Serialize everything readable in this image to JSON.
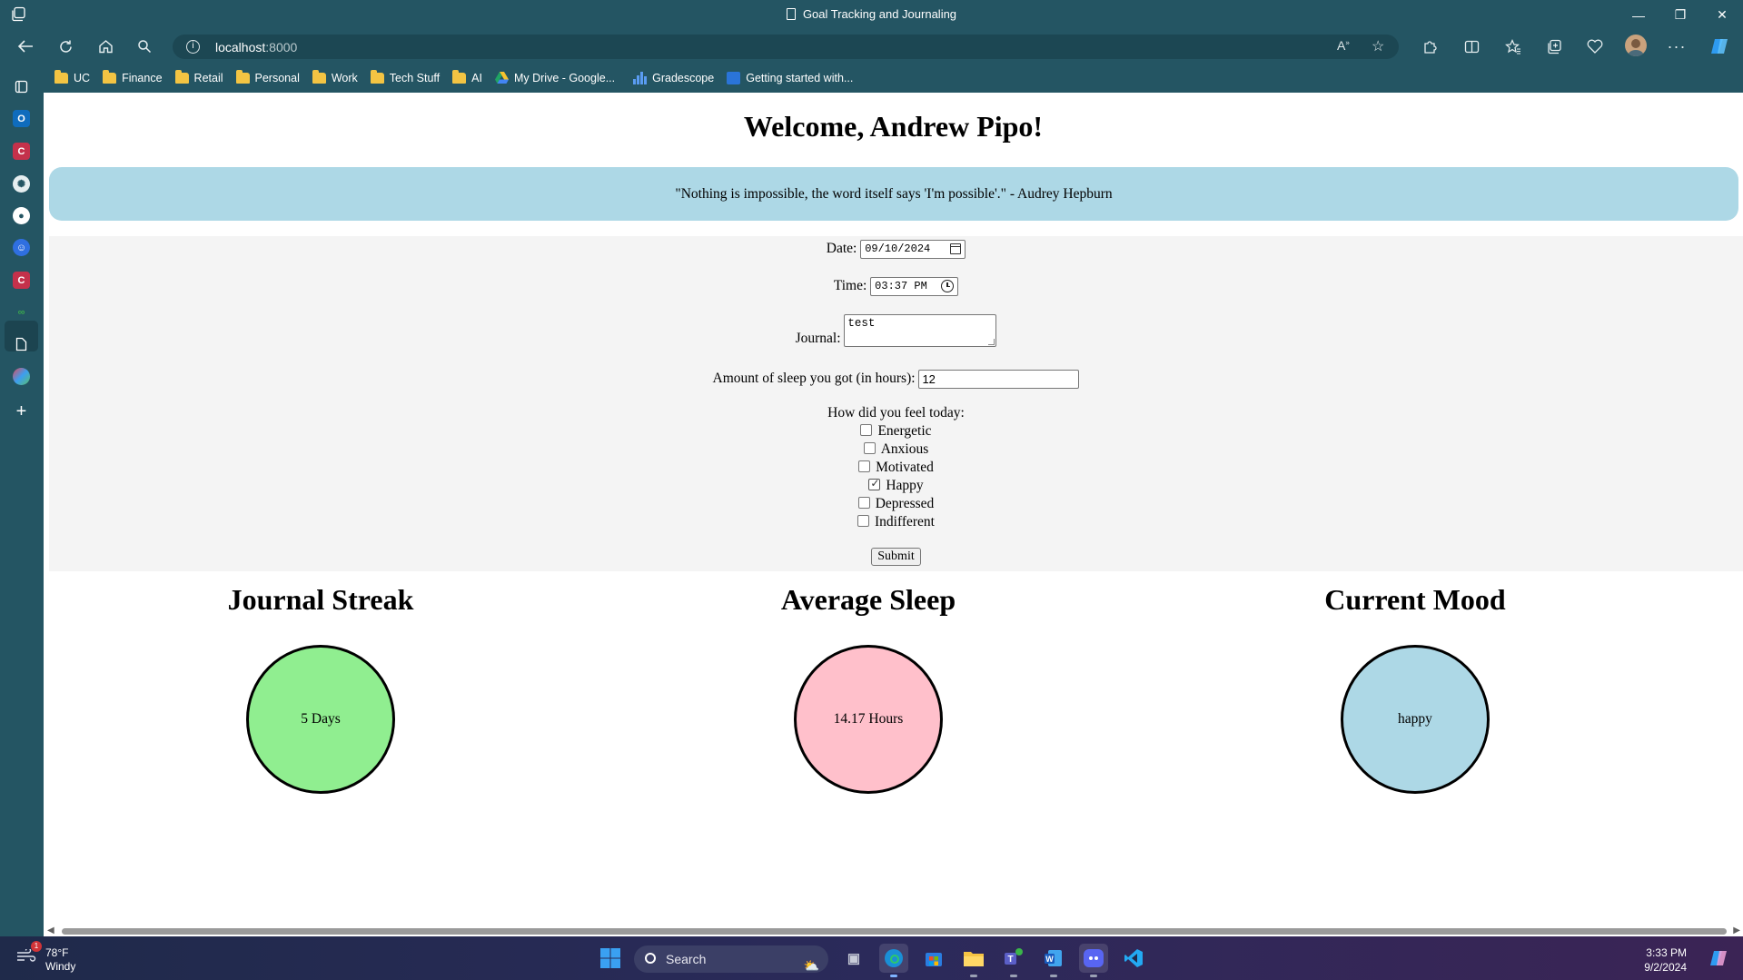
{
  "browser": {
    "window_title": "Goal Tracking and Journaling",
    "url_host": "localhost",
    "url_port": ":8000",
    "bookmarks": [
      {
        "label": "UC",
        "icon": "folder-icon"
      },
      {
        "label": "Finance",
        "icon": "folder-icon"
      },
      {
        "label": "Retail",
        "icon": "folder-icon"
      },
      {
        "label": "Personal",
        "icon": "folder-icon"
      },
      {
        "label": "Work",
        "icon": "folder-icon"
      },
      {
        "label": "Tech Stuff",
        "icon": "folder-icon"
      },
      {
        "label": "AI",
        "icon": "folder-icon"
      },
      {
        "label": "My Drive - Google...",
        "icon": "google-drive-icon"
      },
      {
        "label": "Gradescope",
        "icon": "bar-chart-icon"
      },
      {
        "label": "Getting started with...",
        "icon": "gradescope-icon"
      }
    ]
  },
  "page": {
    "welcome": "Welcome, Andrew Pipo!",
    "quote": "\"Nothing is impossible, the word itself says 'I'm possible'.\" - Audrey Hepburn",
    "form": {
      "date_label": "Date:",
      "date_value": "09/10/2024",
      "time_label": "Time:",
      "time_value": "03:37 PM",
      "journal_label": "Journal:",
      "journal_value": "test",
      "sleep_label": "Amount of sleep you got (in hours):",
      "sleep_value": "12",
      "feel_label": "How did you feel today:",
      "moods": [
        {
          "label": "Energetic",
          "checked": false
        },
        {
          "label": "Anxious",
          "checked": false
        },
        {
          "label": "Motivated",
          "checked": false
        },
        {
          "label": "Happy",
          "checked": true
        },
        {
          "label": "Depressed",
          "checked": false
        },
        {
          "label": "Indifferent",
          "checked": false
        }
      ],
      "submit_label": "Submit"
    },
    "stats": [
      {
        "title": "Journal Streak",
        "value": "5 Days",
        "color": "#90ee90"
      },
      {
        "title": "Average Sleep",
        "value": "14.17 Hours",
        "color": "#ffc0cb"
      },
      {
        "title": "Current Mood",
        "value": "happy",
        "color": "#add8e6"
      }
    ]
  },
  "taskbar": {
    "weather_temp": "78°F",
    "weather_desc": "Windy",
    "search_label": "Search",
    "time": "3:33 PM",
    "date": "9/2/2024"
  }
}
